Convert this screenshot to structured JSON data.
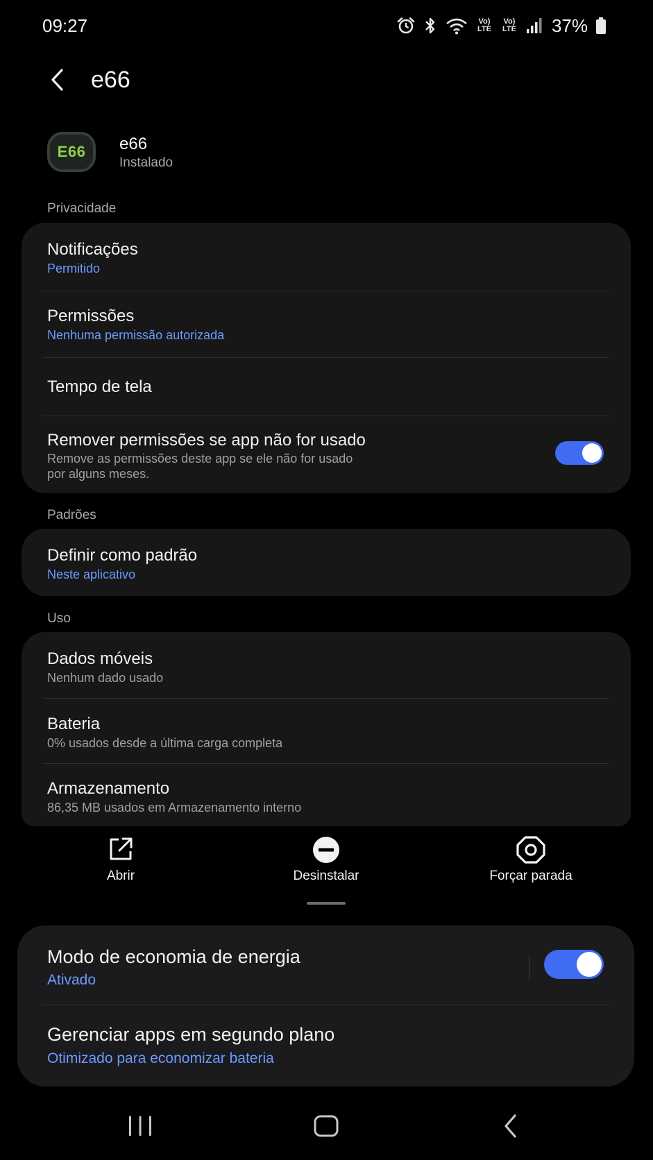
{
  "status_bar": {
    "time": "09:27",
    "battery_percent": "37%",
    "volte_1": "Vo) LTE",
    "volte_2": "Vo) LTE",
    "icons": [
      "alarm-icon",
      "bluetooth-icon",
      "wifi-icon",
      "volte-icon",
      "volte-icon",
      "signal-icon",
      "battery-icon"
    ]
  },
  "header": {
    "title": "e66",
    "back_icon": "chevron-left-icon"
  },
  "app": {
    "icon_text": "E66",
    "name": "e66",
    "status": "Instalado"
  },
  "sections": {
    "privacy": {
      "label": "Privacidade",
      "items": [
        {
          "title": "Notificações",
          "subtitle": "Permitido"
        },
        {
          "title": "Permissões",
          "subtitle": "Nenhuma permissão autorizada"
        },
        {
          "title": "Tempo de tela"
        },
        {
          "title": "Remover permissões se app não for usado",
          "subtitle_line1": "Remove as permissões deste app se ele não for usado",
          "subtitle_line2": "por alguns meses.",
          "toggle_on": true
        }
      ]
    },
    "defaults": {
      "label": "Padrões",
      "items": [
        {
          "title": "Definir como padrão",
          "subtitle": "Neste aplicativo"
        }
      ]
    },
    "usage": {
      "label": "Uso",
      "items": [
        {
          "title": "Dados móveis",
          "subtitle": "Nenhum dado usado"
        },
        {
          "title": "Bateria",
          "subtitle": "0% usados desde a última carga completa"
        },
        {
          "title": "Armazenamento",
          "subtitle": "86,35 MB usados em Armazenamento interno"
        }
      ]
    }
  },
  "actions": [
    {
      "label": "Abrir",
      "icon": "open-external-icon"
    },
    {
      "label": "Desinstalar",
      "icon": "uninstall-icon"
    },
    {
      "label": "Forçar parada",
      "icon": "force-stop-icon"
    }
  ],
  "sheet": {
    "items": [
      {
        "title": "Modo de economia de energia",
        "subtitle": "Ativado",
        "toggle_on": true
      },
      {
        "title": "Gerenciar apps em segundo plano",
        "subtitle": "Otimizado para economizar bateria"
      }
    ]
  },
  "nav_bar": {
    "icons": [
      "recent-apps-icon",
      "home-icon",
      "back-icon"
    ]
  },
  "colors": {
    "accent": "#3f6cf3",
    "link": "#6b9bff",
    "card": "#171717",
    "background": "#000000"
  }
}
